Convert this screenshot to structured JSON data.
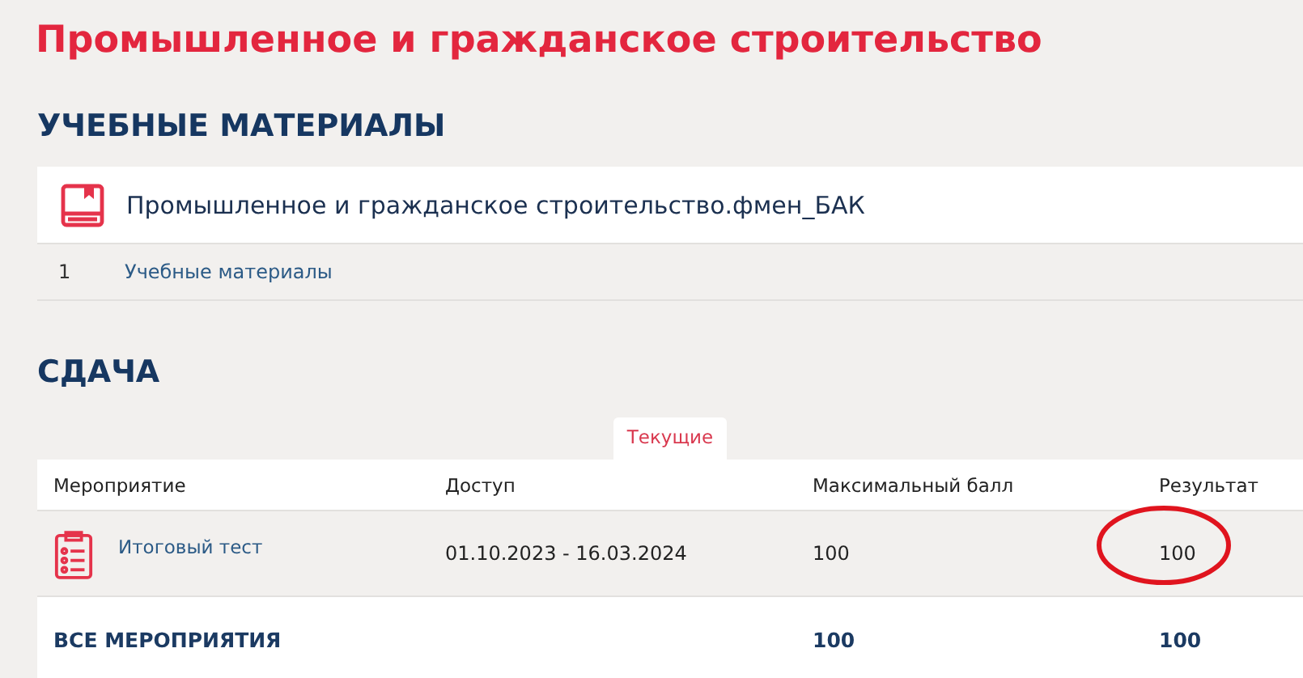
{
  "title": "Промышленное и гражданское строительство",
  "materials": {
    "heading": "УЧЕБНЫЕ МАТЕРИАЛЫ",
    "course": "Промышленное и гражданское строительство.фмен_БАК",
    "items": [
      {
        "number": "1",
        "label": "Учебные материалы"
      }
    ]
  },
  "submission": {
    "heading": "СДАЧА",
    "tabs": [
      {
        "label": "Текущие",
        "selected": true
      }
    ],
    "columns": [
      "Мероприятие",
      "Доступ",
      "Максимальный балл",
      "Результат"
    ],
    "rows": [
      {
        "event": "Итоговый тест",
        "access": "01.10.2023 - 16.03.2024",
        "max_score": "100",
        "result": "100",
        "highlighted": true
      }
    ],
    "total": {
      "label": "ВСЕ МЕРОПРИЯТИЯ",
      "max_score": "100",
      "result": "100"
    }
  }
}
